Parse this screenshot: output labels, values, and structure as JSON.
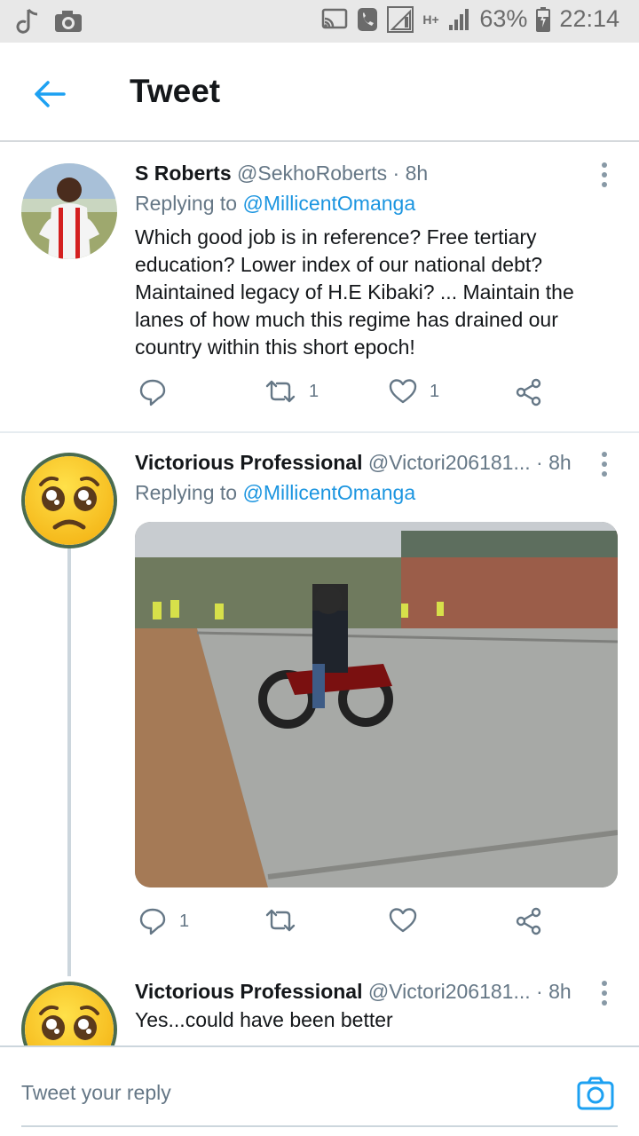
{
  "status_bar": {
    "battery": "63%",
    "time": "22:14",
    "network": "H+",
    "icons_left": [
      "music-note-icon",
      "camera-icon"
    ],
    "icons_right": [
      "cast-icon",
      "call-icon",
      "signal-icon",
      "signal-icon-2",
      "battery-icon"
    ]
  },
  "header": {
    "title": "Tweet",
    "back_icon": "arrow-left-icon"
  },
  "tweets": [
    {
      "name": "S Roberts",
      "handle": "@SekhoRoberts",
      "time": "· 8h",
      "replying_prefix": "Replying to",
      "replying_to": "@MillicentOmanga",
      "text": "Which good job is in reference? Free tertiary education? Lower index of our national debt? Maintained legacy of H.E Kibaki? ... Maintain the lanes of how much this regime has drained our country within this short epoch!",
      "replies": "",
      "retweets": "1",
      "likes": "1"
    },
    {
      "name": "Victorious Professional",
      "handle": "@Victori206181...",
      "time": "· 8h",
      "replying_prefix": "Replying to",
      "replying_to": "@MillicentOmanga",
      "text": "",
      "replies": "1",
      "retweets": "",
      "likes": ""
    },
    {
      "name": "Victorious Professional",
      "handle": "@Victori206181...",
      "time": "· 8h",
      "text": "Yes...could have been better"
    }
  ],
  "reply_bar": {
    "placeholder": "Tweet your reply",
    "camera_icon": "camera-icon"
  },
  "colors": {
    "accent": "#1da1f2",
    "secondary_text": "#657786",
    "divider": "#e6ecf0"
  }
}
